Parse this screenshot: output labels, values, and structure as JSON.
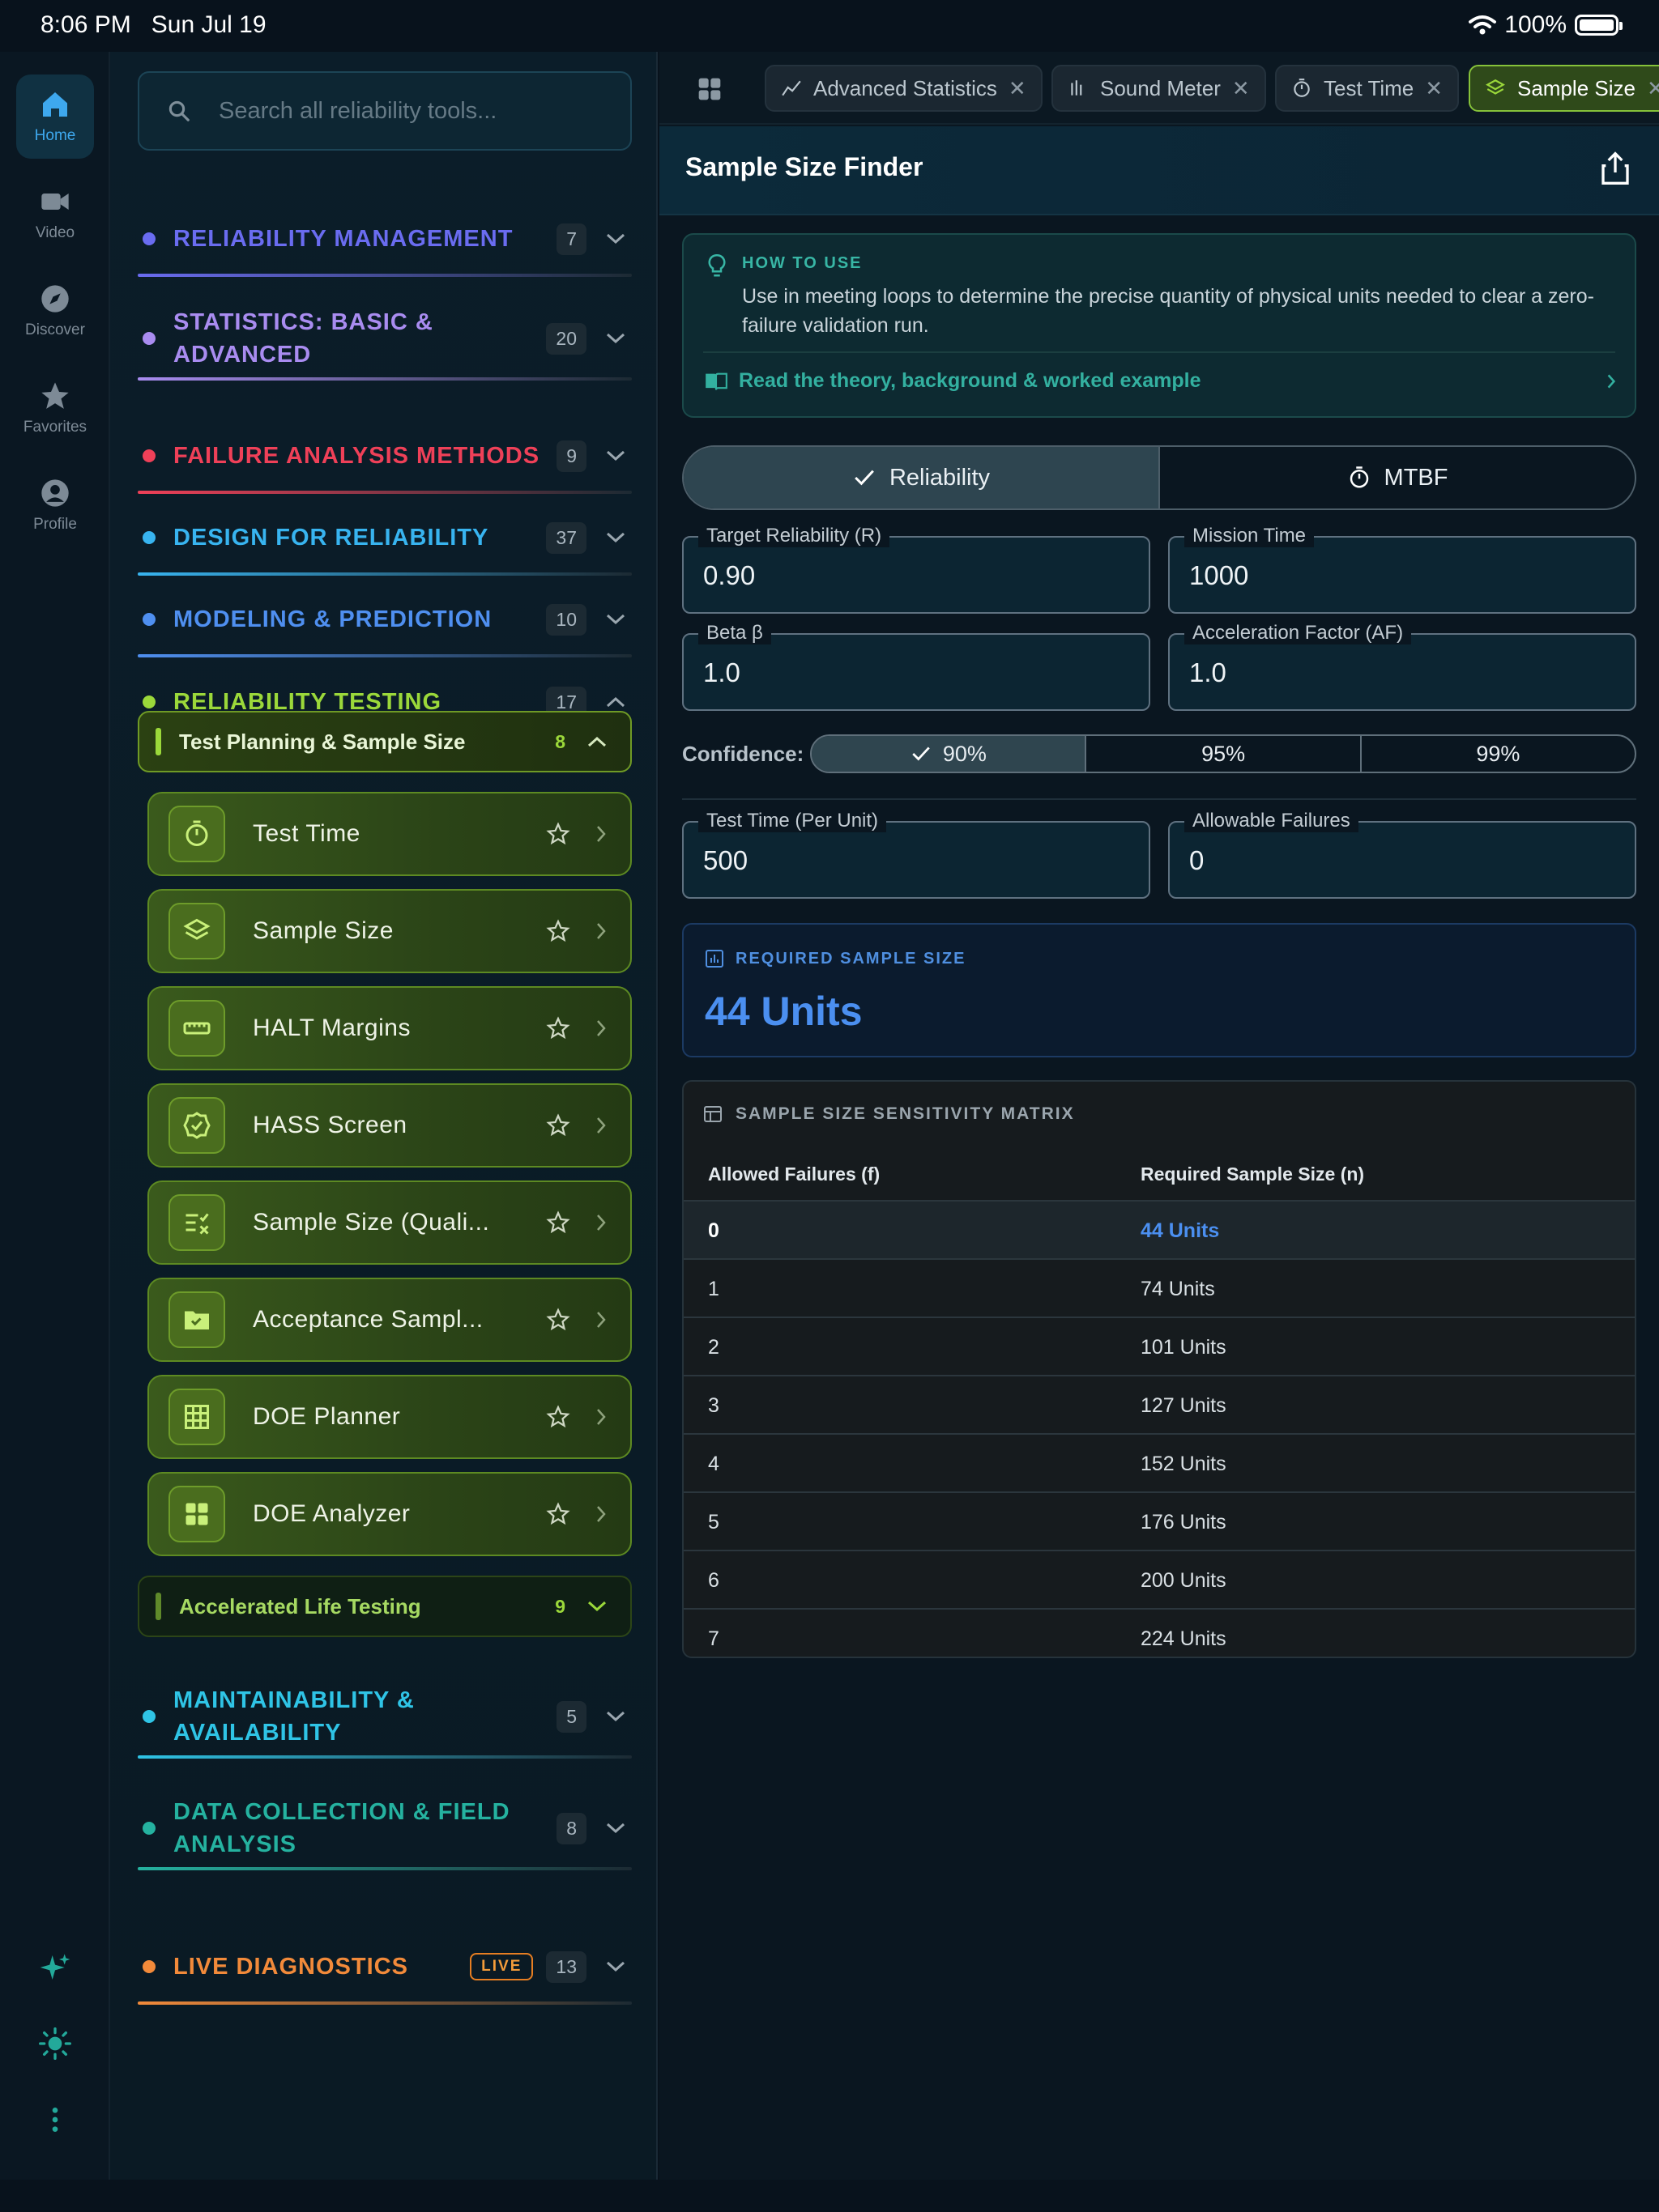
{
  "status": {
    "time": "8:06 PM",
    "date": "Sun Jul 19",
    "battery": "100%"
  },
  "rail": {
    "items": [
      {
        "label": "Home",
        "icon": "home-icon"
      },
      {
        "label": "Video",
        "icon": "video-icon"
      },
      {
        "label": "Discover",
        "icon": "compass-icon"
      },
      {
        "label": "Favorites",
        "icon": "star-icon"
      },
      {
        "label": "Profile",
        "icon": "profile-icon"
      }
    ],
    "bottom_icons": [
      "sparkles-icon",
      "sun-icon",
      "more-icon"
    ]
  },
  "sidebar": {
    "search_placeholder": "Search all reliability tools...",
    "categories": [
      {
        "label": "RELIABILITY MANAGEMENT",
        "count": "7",
        "color": "#6a6cf0"
      },
      {
        "label": "STATISTICS: BASIC & ADVANCED",
        "count": "20",
        "color": "#a98cf0"
      },
      {
        "label": "FAILURE ANALYSIS METHODS",
        "count": "9",
        "color": "#ef4058"
      },
      {
        "label": "DESIGN FOR RELIABILITY",
        "count": "37",
        "color": "#38b4f0"
      },
      {
        "label": "MODELING & PREDICTION",
        "count": "10",
        "color": "#4f8ff0"
      },
      {
        "label": "RELIABILITY TESTING",
        "count": "17",
        "color": "#9bd83a"
      },
      {
        "label": "MAINTAINABILITY & AVAILABILITY",
        "count": "5",
        "color": "#2fc4e6"
      },
      {
        "label": "DATA COLLECTION & FIELD ANALYSIS",
        "count": "8",
        "color": "#25b2a0"
      },
      {
        "label": "LIVE DIAGNOSTICS",
        "count": "13",
        "color": "#f28a3a",
        "badge": "LIVE"
      }
    ],
    "subgroups": [
      {
        "label": "Test Planning & Sample Size",
        "count": "8"
      },
      {
        "label": "Accelerated Life Testing",
        "count": "9"
      }
    ],
    "tools": [
      {
        "label": "Test Time",
        "icon": "stopwatch-icon"
      },
      {
        "label": "Sample Size",
        "icon": "layers-icon"
      },
      {
        "label": "HALT Margins",
        "icon": "ruler-icon"
      },
      {
        "label": "HASS Screen",
        "icon": "badge-check-icon"
      },
      {
        "label": "Sample Size (Quali...",
        "icon": "list-check-icon"
      },
      {
        "label": "Acceptance Sampl...",
        "icon": "folder-check-icon"
      },
      {
        "label": "DOE Planner",
        "icon": "grid-icon"
      },
      {
        "label": "DOE Analyzer",
        "icon": "dashboard-icon"
      }
    ]
  },
  "tabs": [
    {
      "label": "Advanced Statistics",
      "icon": "chart-line-icon"
    },
    {
      "label": "Sound Meter",
      "icon": "sound-icon"
    },
    {
      "label": "Test Time",
      "icon": "stopwatch-icon"
    },
    {
      "label": "Sample Size",
      "icon": "layers-icon"
    }
  ],
  "main": {
    "title": "Sample Size Finder",
    "howto": {
      "heading": "HOW TO USE",
      "text": "Use in meeting loops to determine the precise quantity of physical units needed to clear a zero-failure validation run.",
      "link": "Read the theory, background & worked example"
    },
    "mode": {
      "reliability": "Reliability",
      "mtbf": "MTBF"
    },
    "fields": {
      "target_reliability": {
        "label": "Target Reliability (R)",
        "value": "0.90"
      },
      "mission_time": {
        "label": "Mission Time",
        "value": "1000"
      },
      "beta": {
        "label": "Beta β",
        "value": "1.0"
      },
      "acceleration_factor": {
        "label": "Acceleration Factor (AF)",
        "value": "1.0"
      },
      "test_time": {
        "label": "Test Time (Per Unit)",
        "value": "500"
      },
      "allowable_failures": {
        "label": "Allowable Failures",
        "value": "0"
      }
    },
    "confidence": {
      "label": "Confidence:",
      "options": [
        "90%",
        "95%",
        "99%"
      ]
    },
    "result": {
      "heading": "REQUIRED SAMPLE SIZE",
      "value": "44 Units"
    },
    "matrix": {
      "heading": "SAMPLE SIZE SENSITIVITY MATRIX",
      "col1": "Allowed Failures (f)",
      "col2": "Required Sample Size (n)",
      "rows": [
        [
          "0",
          "44 Units"
        ],
        [
          "1",
          "74 Units"
        ],
        [
          "2",
          "101 Units"
        ],
        [
          "3",
          "127 Units"
        ],
        [
          "4",
          "152 Units"
        ],
        [
          "5",
          "176 Units"
        ],
        [
          "6",
          "200 Units"
        ],
        [
          "7",
          "224 Units"
        ]
      ]
    }
  }
}
